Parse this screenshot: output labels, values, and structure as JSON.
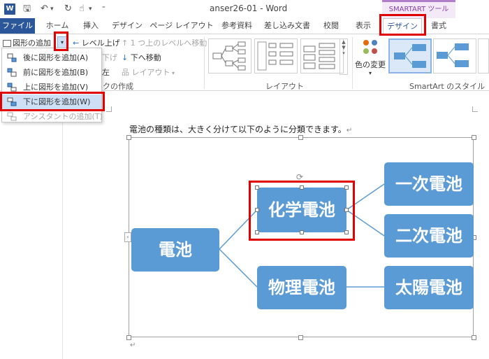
{
  "window": {
    "title": "anser26-01 - Word",
    "contextual_tab_group": "SMARTART ツール"
  },
  "tabs": [
    {
      "label": "ファイル"
    },
    {
      "label": "ホーム"
    },
    {
      "label": "挿入"
    },
    {
      "label": "デザイン"
    },
    {
      "label": "ページ レイアウト"
    },
    {
      "label": "参考資料"
    },
    {
      "label": "差し込み文書"
    },
    {
      "label": "校閲"
    },
    {
      "label": "表示"
    },
    {
      "label": "デザイン"
    },
    {
      "label": "書式"
    }
  ],
  "ribbon": {
    "add_shape": "図形の追加",
    "level_up": "レベル上げ",
    "level_down": "下げ",
    "move_up": "1 つ上のレベルへ移動",
    "move_down": "下へ移動",
    "rtl": "左",
    "layout_btn": "レイアウト",
    "create_graphic_group": "クの作成",
    "layouts_group": "レイアウト",
    "change_colors": "色の変更",
    "styles_group": "SmartArt のスタイル"
  },
  "dropdown": {
    "items": [
      {
        "label": "後に図形を追加(A)"
      },
      {
        "label": "前に図形を追加(B)"
      },
      {
        "label": "上に図形を追加(V)"
      },
      {
        "label": "下に図形を追加(W)"
      },
      {
        "label": "アシスタントの追加(T)"
      }
    ]
  },
  "document": {
    "body_text": "電池の種類は、大きく分けて以下のように分類できます。",
    "para_mark": "↵"
  },
  "smartart": {
    "nodes": [
      {
        "label": "電池"
      },
      {
        "label": "化学電池"
      },
      {
        "label": "物理電池"
      },
      {
        "label": "一次電池"
      },
      {
        "label": "二次電池"
      },
      {
        "label": "太陽電池"
      }
    ]
  },
  "colors": {
    "accent": "#2b579a",
    "node_fill": "#5b9bd5",
    "highlight_red": "#e00000",
    "contextual_purple": "#8b3fae"
  }
}
